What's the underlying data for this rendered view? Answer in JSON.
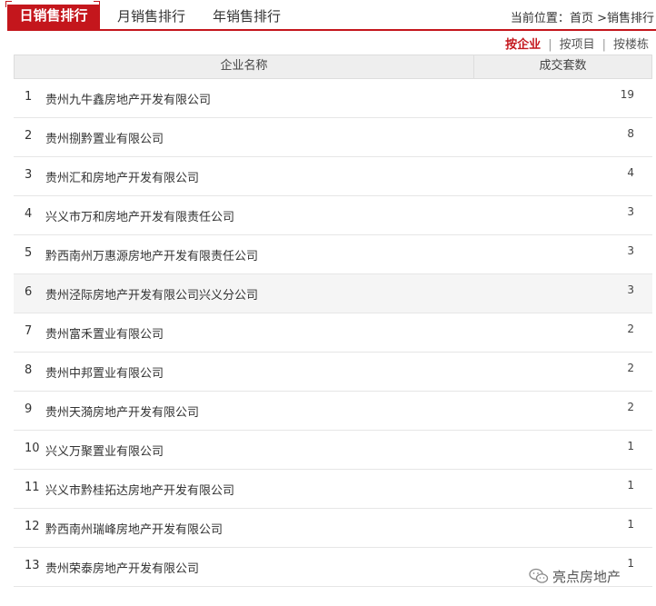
{
  "tabs": [
    {
      "label": "日销售排行",
      "active": true
    },
    {
      "label": "月销售排行",
      "active": false
    },
    {
      "label": "年销售排行",
      "active": false
    }
  ],
  "breadcrumb": {
    "prefix": "当前位置：",
    "home": "首页",
    "separator": " >",
    "current": "销售排行"
  },
  "sort_options": [
    {
      "label": "按企业",
      "active": true
    },
    {
      "label": "按项目",
      "active": false
    },
    {
      "label": "按楼栋",
      "active": false
    }
  ],
  "sort_separator": "|",
  "table": {
    "headers": [
      "企业名称",
      "成交套数"
    ],
    "rows": [
      {
        "index": "1",
        "name": "贵州九牛鑫房地产开发有限公司",
        "count": "19"
      },
      {
        "index": "2",
        "name": "贵州捌黔置业有限公司",
        "count": "8"
      },
      {
        "index": "3",
        "name": "贵州汇和房地产开发有限公司",
        "count": "4"
      },
      {
        "index": "4",
        "name": "兴义市万和房地产开发有限责任公司",
        "count": "3"
      },
      {
        "index": "5",
        "name": "黔西南州万惠源房地产开发有限责任公司",
        "count": "3"
      },
      {
        "index": "6",
        "name": "贵州泾际房地产开发有限公司兴义分公司",
        "count": "3"
      },
      {
        "index": "7",
        "name": "贵州富禾置业有限公司",
        "count": "2"
      },
      {
        "index": "8",
        "name": "贵州中邦置业有限公司",
        "count": "2"
      },
      {
        "index": "9",
        "name": "贵州天漪房地产开发有限公司",
        "count": "2"
      },
      {
        "index": "10",
        "name": "兴义万聚置业有限公司",
        "count": "1"
      },
      {
        "index": "11",
        "name": "兴义市黔桂拓达房地产开发有限公司",
        "count": "1"
      },
      {
        "index": "12",
        "name": "黔西南州瑞峰房地产开发有限公司",
        "count": "1"
      },
      {
        "index": "13",
        "name": "贵州荣泰房地产开发有限公司",
        "count": "1"
      }
    ]
  },
  "watermark": {
    "text": "亮点房地产",
    "icon": "wechat-icon"
  },
  "colors": {
    "accent": "#c4161c",
    "header_bg": "#eeeeee"
  }
}
